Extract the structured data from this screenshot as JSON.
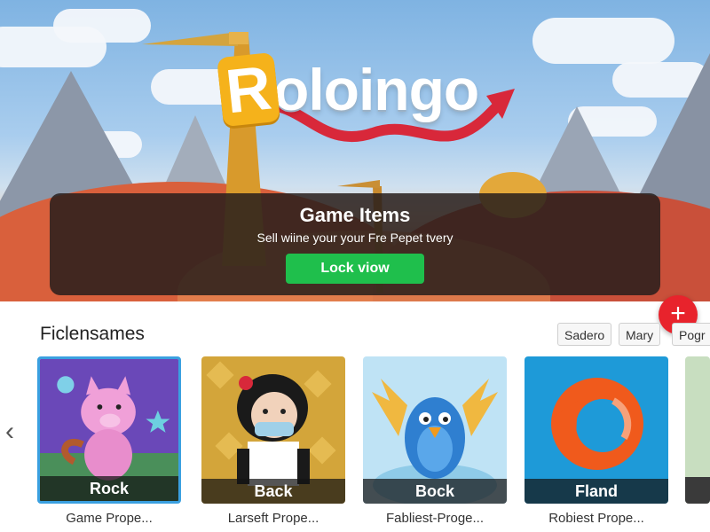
{
  "hero": {
    "logo_first_letter": "R",
    "logo_rest": "oloingo",
    "banner_title": "Game Items",
    "banner_subtitle": "Sell wiine your your Fre Pepet tvery",
    "banner_button": "Lock viow"
  },
  "fab": {
    "label": "+"
  },
  "section": {
    "title": "Ficlensames",
    "filters": [
      "Sadero",
      "Mary",
      "Pogr"
    ]
  },
  "cards": [
    {
      "label": "Rock",
      "caption": "Game Prope..."
    },
    {
      "label": "Back",
      "caption": "Larseft Prope..."
    },
    {
      "label": "Bock",
      "caption": "Fabliest-Proge..."
    },
    {
      "label": "Fland",
      "caption": "Robiest Prope..."
    }
  ],
  "colors": {
    "accent_green": "#1fbf4c",
    "fab_red": "#e8232c",
    "selected_border": "#3aa0e0"
  }
}
